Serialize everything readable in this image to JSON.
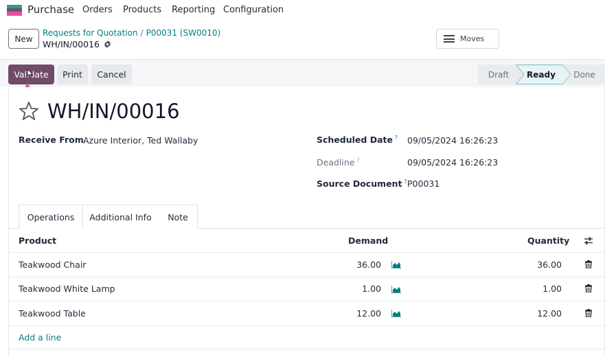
{
  "app": {
    "name": "Purchase"
  },
  "nav": {
    "items": [
      "Orders",
      "Products",
      "Reporting",
      "Configuration"
    ]
  },
  "control_panel": {
    "new_label": "New",
    "breadcrumbs": [
      "Requests for Quotation",
      "P00031 (SW0010)"
    ],
    "breadcrumb_sep": "/",
    "record_name": "WH/IN/00016",
    "moves_label": "Moves"
  },
  "actions": {
    "validate": "Validate",
    "print": "Print",
    "cancel": "Cancel"
  },
  "statusbar": {
    "steps": [
      "Draft",
      "Ready",
      "Done"
    ],
    "active": "Ready"
  },
  "form": {
    "title": "WH/IN/00016",
    "receive_from_label": "Receive From",
    "receive_from_value": "Azure Interior, Ted Wallaby",
    "scheduled_date_label": "Scheduled Date",
    "scheduled_date_value": "09/05/2024 16:26:23",
    "deadline_label": "Deadline",
    "deadline_value": "09/05/2024 16:26:23",
    "source_document_label": "Source Document",
    "source_document_value": "P00031",
    "help_marker": "?"
  },
  "tabs": [
    "Operations",
    "Additional Info",
    "Note"
  ],
  "table": {
    "headers": {
      "product": "Product",
      "demand": "Demand",
      "quantity": "Quantity"
    },
    "rows": [
      {
        "product": "Teakwood Chair",
        "demand": "36.00",
        "quantity": "36.00"
      },
      {
        "product": "Teakwood White Lamp",
        "demand": "1.00",
        "quantity": "1.00"
      },
      {
        "product": "Teakwood Table",
        "demand": "12.00",
        "quantity": "12.00"
      }
    ],
    "add_line": "Add a line"
  },
  "colors": {
    "brand": "#714b67",
    "link": "#017e84",
    "annotation": "#e0539b"
  }
}
